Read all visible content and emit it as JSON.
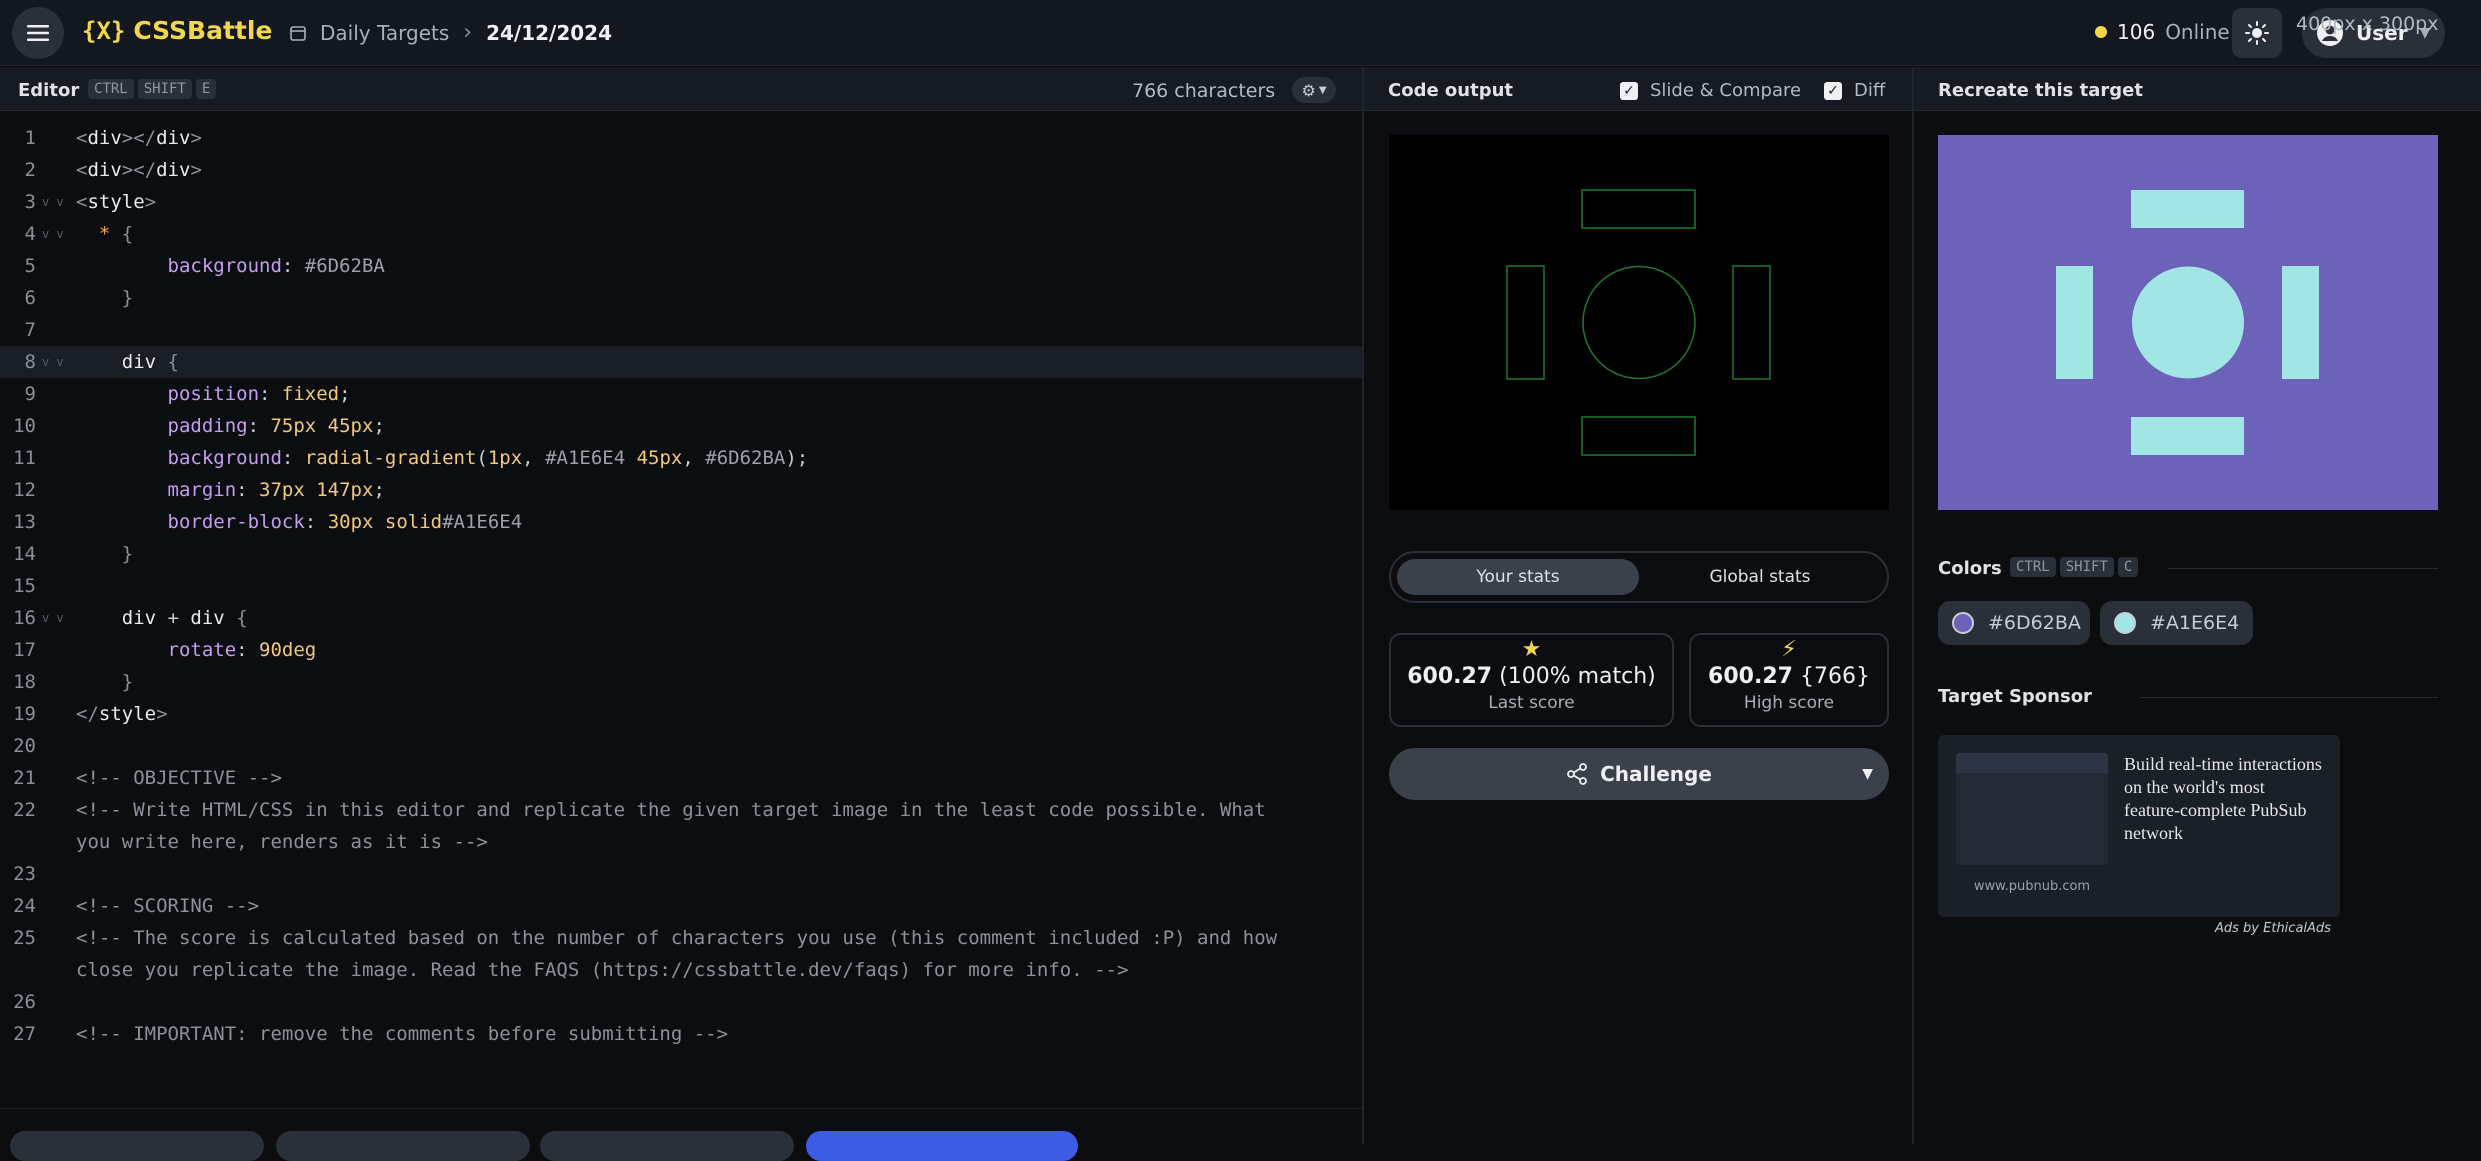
{
  "app": {
    "name": "CSSBattle",
    "logo_mark": "{X}"
  },
  "breadcrumb": {
    "section": "Daily Targets",
    "date": "24/12/2024"
  },
  "online": {
    "count": "106",
    "label": "Online"
  },
  "user": {
    "name": "User"
  },
  "editor": {
    "title": "Editor",
    "shortcut": [
      "CTRL",
      "SHIFT",
      "E"
    ],
    "char_count": "766 characters",
    "lines": [
      {
        "n": "1",
        "html": "<span class='br'>&lt;</span><span class='tag'>div</span><span class='br'>&gt;&lt;/</span><span class='tag'>div</span><span class='br'>&gt;</span>"
      },
      {
        "n": "2",
        "html": "<span class='br'>&lt;</span><span class='tag'>div</span><span class='br'>&gt;&lt;/</span><span class='tag'>div</span><span class='br'>&gt;</span>"
      },
      {
        "n": "3",
        "fold": true,
        "html": "<span class='br'>&lt;</span><span class='tag'>style</span><span class='br'>&gt;</span>"
      },
      {
        "n": "4",
        "fold": true,
        "html": "  <span class='star'>*</span> <span class='br'>{</span>"
      },
      {
        "n": "5",
        "html": "        <span class='prop'>background</span>: <span class='hex'>#6D62BA</span>"
      },
      {
        "n": "6",
        "html": "    <span class='br'>}</span>"
      },
      {
        "n": "7",
        "html": ""
      },
      {
        "n": "8",
        "fold": true,
        "active": true,
        "html": "    <span class='tag'>div</span> <span class='br'>{</span>"
      },
      {
        "n": "9",
        "html": "        <span class='prop'>position</span>: <span class='val'>fixed</span>;"
      },
      {
        "n": "10",
        "html": "        <span class='prop'>padding</span>: <span class='val'>75px 45px</span>;"
      },
      {
        "n": "11",
        "html": "        <span class='prop'>background</span>: <span class='val'>radial-gradient</span>(<span class='val'>1px</span>, <span class='hex'>#A1E6E4</span> <span class='val'>45px</span>, <span class='hex'>#6D62BA</span>);"
      },
      {
        "n": "12",
        "html": "        <span class='prop'>margin</span>: <span class='val'>37px 147px</span>;"
      },
      {
        "n": "13",
        "html": "        <span class='prop'>border-block</span>: <span class='val'>30px solid</span><span class='hex'>#A1E6E4</span>"
      },
      {
        "n": "14",
        "html": "    <span class='br'>}</span>"
      },
      {
        "n": "15",
        "html": ""
      },
      {
        "n": "16",
        "fold": true,
        "html": "    <span class='tag'>div</span> + <span class='tag'>div</span> <span class='br'>{</span>"
      },
      {
        "n": "17",
        "html": "        <span class='prop'>rotate</span>: <span class='val'>90deg</span>"
      },
      {
        "n": "18",
        "html": "    <span class='br'>}</span>"
      },
      {
        "n": "19",
        "html": "<span class='br'>&lt;/</span><span class='tag'>style</span><span class='br'>&gt;</span>"
      },
      {
        "n": "20",
        "html": ""
      },
      {
        "n": "21",
        "html": "<span class='cm'>&lt;!-- OBJECTIVE --&gt;</span>"
      },
      {
        "n": "22",
        "html": "<span class='cm'>&lt;!-- Write HTML/CSS in this editor and replicate the given target image in the least code possible. What</span>"
      },
      {
        "n": "",
        "html": "<span class='cm'>you write here, renders as it is --&gt;</span>"
      },
      {
        "n": "23",
        "html": ""
      },
      {
        "n": "24",
        "html": "<span class='cm'>&lt;!-- SCORING --&gt;</span>"
      },
      {
        "n": "25",
        "html": "<span class='cm'>&lt;!-- The score is calculated based on the number of characters you use (this comment included :P) and how</span>"
      },
      {
        "n": "",
        "html": "<span class='cm'>close you replicate the image. Read the FAQS (https://cssbattle.dev/faqs) for more info. --&gt;</span>"
      },
      {
        "n": "26",
        "html": ""
      },
      {
        "n": "27",
        "html": "<span class='cm'>&lt;!-- IMPORTANT: remove the comments before submitting --&gt;</span>"
      }
    ]
  },
  "output": {
    "title": "Code output",
    "slide_compare": "Slide & Compare",
    "diff": "Diff"
  },
  "stats": {
    "tabs": [
      "Your stats",
      "Global stats"
    ],
    "last": {
      "score": "600.27",
      "detail": "(100% match)",
      "label": "Last score"
    },
    "high": {
      "score": "600.27",
      "detail": "{766}",
      "label": "High score"
    }
  },
  "challenge": {
    "label": "Challenge"
  },
  "target": {
    "title": "Recreate this target",
    "dimensions": "400px x 300px",
    "bg": "#6D62BA",
    "fg": "#A1E6E4"
  },
  "colors": {
    "title": "Colors",
    "shortcut": [
      "CTRL",
      "SHIFT",
      "C"
    ],
    "items": [
      {
        "hex": "#6D62BA"
      },
      {
        "hex": "#A1E6E4"
      }
    ]
  },
  "sponsor": {
    "title": "Target Sponsor",
    "text": "Build real-time interactions on the world's most feature-complete PubSub network",
    "url": "www.pubnub.com",
    "ads_by": "Ads by EthicalAds"
  }
}
